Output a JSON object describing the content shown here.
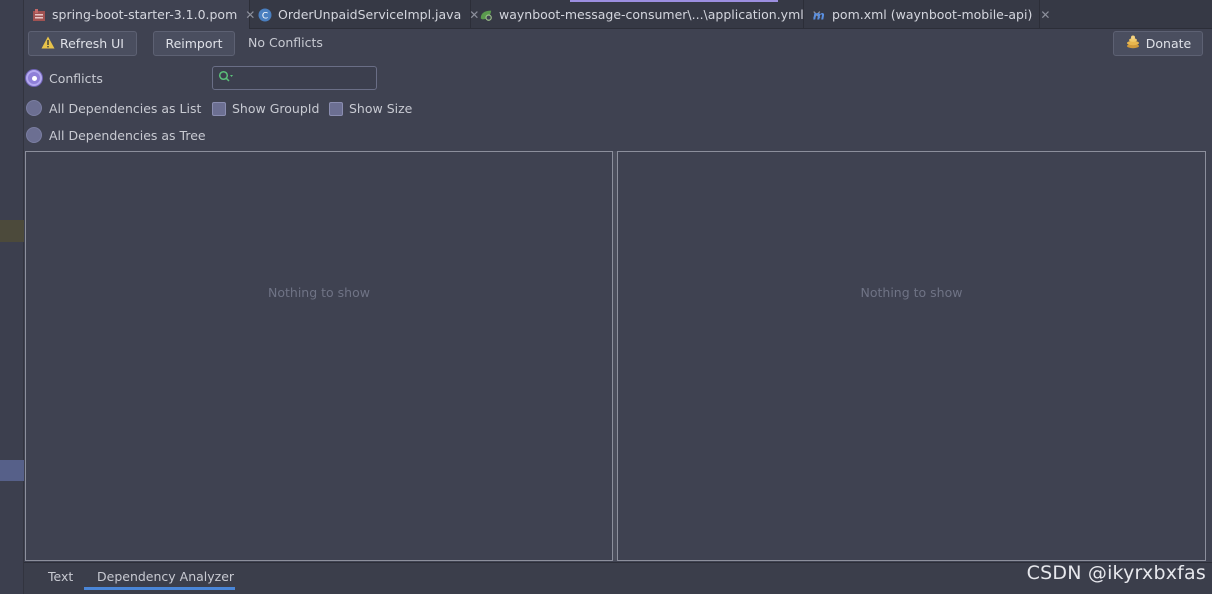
{
  "tabs": [
    {
      "label": "spring-boot-starter-3.1.0.pom",
      "icon": "maven-pom-icon",
      "active": true
    },
    {
      "label": "OrderUnpaidServiceImpl.java",
      "icon": "java-class-icon",
      "active": false
    },
    {
      "label": "waynboot-message-consumer\\...\\application.yml",
      "icon": "spring-yml-icon",
      "active": false
    },
    {
      "label": "pom.xml (waynboot-mobile-api)",
      "icon": "maven-m-icon",
      "active": false
    }
  ],
  "toolbar": {
    "refresh_label": "Refresh UI",
    "reimport_label": "Reimport",
    "status": "No Conflicts",
    "donate_label": "Donate"
  },
  "view_modes": [
    {
      "label": "Conflicts",
      "selected": true
    },
    {
      "label": "All Dependencies as List",
      "selected": false
    },
    {
      "label": "All Dependencies as Tree",
      "selected": false
    }
  ],
  "search": {
    "value": "",
    "placeholder": ""
  },
  "options": {
    "show_group_id_label": "Show GroupId",
    "show_size_label": "Show Size"
  },
  "left_panel": {
    "empty_text": "Nothing to show"
  },
  "right_panel": {
    "empty_text": "Nothing to show"
  },
  "bottom_tabs": [
    {
      "label": "Text",
      "active": false
    },
    {
      "label": "Dependency Analyzer",
      "active": true
    }
  ],
  "watermark": "CSDN @ikyrxbxfas",
  "colors": {
    "background": "#3f4251",
    "accent": "#9c8fe0",
    "active_tab_underline": "#4a86d8"
  }
}
